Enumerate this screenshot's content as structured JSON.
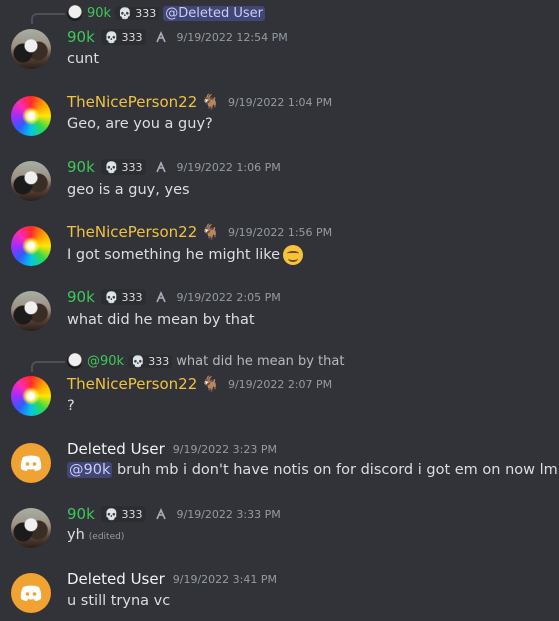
{
  "reply_1": {
    "author": "90k",
    "tag": "333",
    "target": "@Deleted User"
  },
  "messages": [
    {
      "author": "90k",
      "tag": "333",
      "time": "9/19/2022 12:54 PM",
      "text": "cunt"
    },
    {
      "author": "TheNicePerson22",
      "time": "9/19/2022 1:04 PM",
      "text": "Geo, are you a guy?"
    },
    {
      "author": "90k",
      "tag": "333",
      "time": "9/19/2022 1:06 PM",
      "text": "geo is a guy, yes"
    },
    {
      "author": "TheNicePerson22",
      "time": "9/19/2022 1:56 PM",
      "text": "I got something he might like"
    },
    {
      "author": "90k",
      "tag": "333",
      "time": "9/19/2022 2:05 PM",
      "text": "what did he mean by that"
    },
    {
      "author": "TheNicePerson22",
      "time": "9/19/2022 2:07 PM",
      "text": "?"
    },
    {
      "author": "Deleted User",
      "time": "9/19/2022 3:23 PM",
      "mention": "@90k",
      "text": "bruh mb i don't have notis on for discord i got em on now lmk"
    },
    {
      "author": "90k",
      "tag": "333",
      "time": "9/19/2022 3:33 PM",
      "text": "yh",
      "edited": "(edited)"
    },
    {
      "author": "Deleted User",
      "time": "9/19/2022 3:41 PM",
      "text": "u still tryna vc"
    }
  ],
  "reply_2": {
    "author": "@90k",
    "tag": "333",
    "text": "what did he mean by that"
  },
  "icons": {
    "skull": "skull-icon",
    "goat": "goat-icon",
    "discord": "discord-logo-icon",
    "role": "role-icon"
  },
  "colors": {
    "background": "#313338",
    "green_name": "#3fc75a",
    "yellow_name": "#f0c341",
    "mention_bg": "#414675",
    "timestamp": "#949ba4"
  }
}
